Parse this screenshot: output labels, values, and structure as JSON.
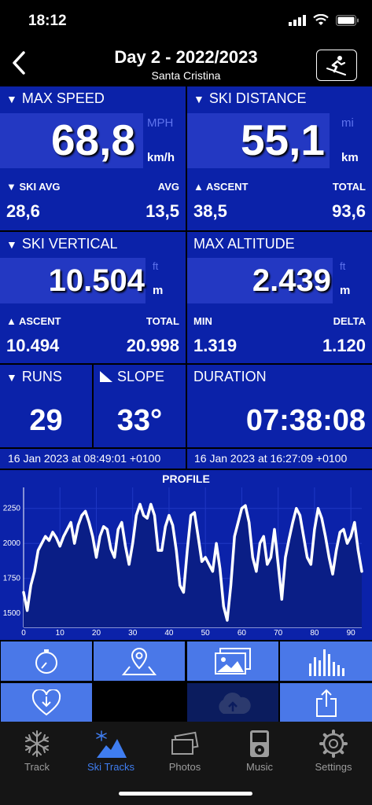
{
  "status": {
    "time": "18:12"
  },
  "header": {
    "title": "Day 2 - 2022/2023",
    "subtitle": "Santa Cristina"
  },
  "max_speed": {
    "label": "MAX SPEED",
    "value": "68,8",
    "unit_alt": "MPH",
    "unit": "km/h",
    "left_label": "SKI AVG",
    "right_label": "AVG",
    "left_value": "28,6",
    "right_value": "13,5"
  },
  "ski_distance": {
    "label": "SKI DISTANCE",
    "value": "55,1",
    "unit_alt": "mi",
    "unit": "km",
    "left_label": "ASCENT",
    "right_label": "TOTAL",
    "left_value": "38,5",
    "right_value": "93,6"
  },
  "ski_vertical": {
    "label": "SKI VERTICAL",
    "value": "10.504",
    "unit_alt": "ft",
    "unit": "m",
    "left_label": "ASCENT",
    "right_label": "TOTAL",
    "left_value": "10.494",
    "right_value": "20.998"
  },
  "max_altitude": {
    "label": "MAX ALTITUDE",
    "value": "2.439",
    "unit_alt": "ft",
    "unit": "m",
    "left_label": "MIN",
    "right_label": "DELTA",
    "left_value": "1.319",
    "right_value": "1.120"
  },
  "runs": {
    "label": "RUNS",
    "value": "29"
  },
  "slope": {
    "label": "SLOPE",
    "value": "33°"
  },
  "duration": {
    "label": "DURATION",
    "value": "07:38:08"
  },
  "start_time": "16 Jan 2023 at 08:49:01 +0100",
  "end_time": "16 Jan 2023 at 16:27:09 +0100",
  "chart_data": {
    "type": "area",
    "title": "PROFILE",
    "xlabel": "",
    "ylabel": "",
    "xlim": [
      0,
      93
    ],
    "ylim": [
      1400,
      2400
    ],
    "x_ticks": [
      0,
      10,
      20,
      30,
      40,
      50,
      60,
      70,
      80,
      90
    ],
    "y_ticks": [
      1500,
      1750,
      2000,
      2250
    ],
    "series": [
      {
        "x": [
          0,
          1,
          2,
          3,
          4,
          5,
          6,
          7,
          8,
          9,
          10,
          11,
          12,
          13,
          14,
          15,
          16,
          17,
          18,
          19,
          20,
          21,
          22,
          23,
          24,
          25,
          26,
          27,
          28,
          29,
          30,
          31,
          32,
          33,
          34,
          35,
          36,
          37,
          38,
          39,
          40,
          41,
          42,
          43,
          44,
          45,
          46,
          47,
          48,
          49,
          50,
          51,
          52,
          53,
          54,
          55,
          56,
          57,
          58,
          59,
          60,
          61,
          62,
          63,
          64,
          65,
          66,
          67,
          68,
          69,
          70,
          71,
          72,
          73,
          74,
          75,
          76,
          77,
          78,
          79,
          80,
          81,
          82,
          83,
          84,
          85,
          86,
          87,
          88,
          89,
          90,
          91,
          92,
          93
        ],
        "y": [
          1650,
          1520,
          1700,
          1800,
          1950,
          2000,
          2050,
          2020,
          2080,
          2040,
          1980,
          2050,
          2100,
          2150,
          2000,
          2130,
          2200,
          2230,
          2150,
          2050,
          1900,
          2050,
          2120,
          2100,
          1960,
          1900,
          2100,
          2150,
          1980,
          1850,
          2000,
          2200,
          2280,
          2200,
          2180,
          2280,
          2200,
          1950,
          1950,
          2120,
          2200,
          2130,
          1950,
          1700,
          1650,
          1950,
          2200,
          2220,
          2050,
          1870,
          1900,
          1850,
          1800,
          2000,
          1820,
          1550,
          1450,
          1700,
          2050,
          2150,
          2250,
          2270,
          2150,
          1900,
          1800,
          2000,
          2050,
          1850,
          1900,
          2100,
          1850,
          1600,
          1900,
          2030,
          2150,
          2250,
          2200,
          2050,
          1900,
          1850,
          2100,
          2250,
          2180,
          2050,
          1900,
          1780,
          1950,
          2080,
          2100,
          2000,
          2050,
          2150,
          1950,
          1800
        ],
        "color": "#ffffff"
      }
    ]
  },
  "toolbar": {
    "row1": [
      "stopwatch-icon",
      "map-pin-icon",
      "photos-icon",
      "bar-chart-icon"
    ],
    "row2": [
      "heart-download-icon",
      "",
      "cloud-upload-icon",
      "share-icon"
    ]
  },
  "tabs": [
    {
      "label": "Track",
      "icon": "snowflake-icon"
    },
    {
      "label": "Ski Tracks",
      "icon": "ski-tracks-icon",
      "active": true
    },
    {
      "label": "Photos",
      "icon": "photos-tab-icon"
    },
    {
      "label": "Music",
      "icon": "music-icon"
    },
    {
      "label": "Settings",
      "icon": "gear-icon"
    }
  ],
  "colors": {
    "panel": "#0b22a9",
    "highlight": "#2338c2",
    "tile": "#4a78e8",
    "tab_active": "#3f7df0"
  }
}
